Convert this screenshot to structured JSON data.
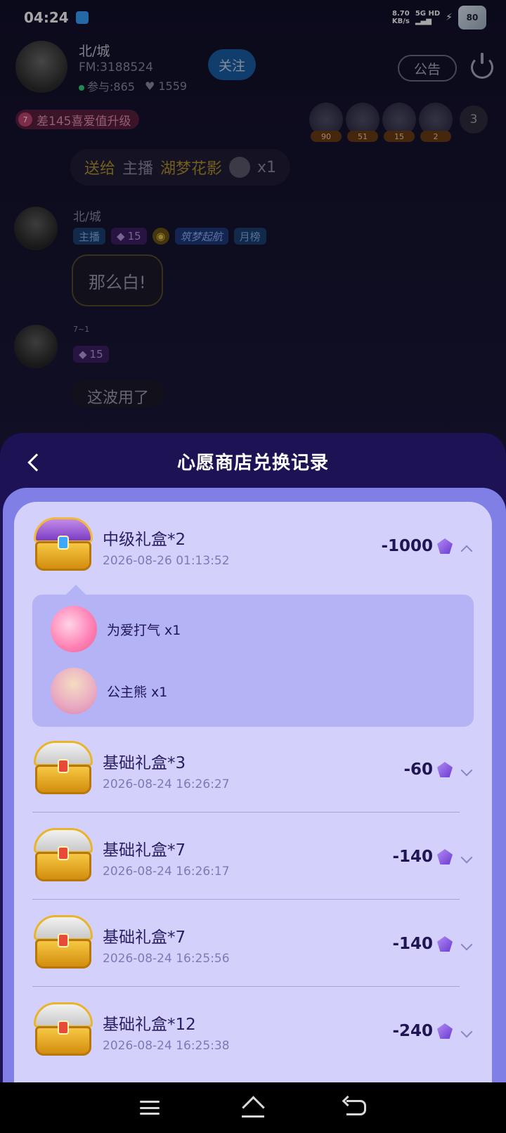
{
  "status_bar": {
    "time": "04:24",
    "net_speed": "8.70",
    "net_unit": "KB/s",
    "network": "5G HD",
    "battery": "80"
  },
  "room": {
    "host_name": "北/城",
    "fm_id": "FM:3188524",
    "participants": "参与:865",
    "likes": "1559",
    "follow_label": "关注",
    "notice_label": "公告",
    "love_level_num": "7",
    "love_level_text": "差145喜爱值升级",
    "viewers": [
      {
        "tag": "90"
      },
      {
        "tag": "51"
      },
      {
        "tag": "15"
      },
      {
        "tag": "2"
      }
    ],
    "viewer_count": "3",
    "gift_msg": {
      "prefix": "送给",
      "role": "主播",
      "target": "湖梦花影",
      "count": "x1"
    },
    "chat": [
      {
        "name": "北/城",
        "badges": [
          "主播",
          "15",
          "",
          "筑梦起航",
          "月榜"
        ],
        "message": "那么白!"
      },
      {
        "name": "7~1",
        "badges": [
          "15"
        ],
        "message": "这波用了"
      }
    ]
  },
  "sheet": {
    "title": "心愿商店兑换记录",
    "records": [
      {
        "title": "中级礼盒*2",
        "time": "2026-08-26 01:13:52",
        "amount": "-1000",
        "expanded": true,
        "items": [
          {
            "label": "为爱打气 x1"
          },
          {
            "label": "公主熊 x1"
          }
        ]
      },
      {
        "title": "基础礼盒*3",
        "time": "2026-08-24 16:26:27",
        "amount": "-60"
      },
      {
        "title": "基础礼盒*7",
        "time": "2026-08-24 16:26:17",
        "amount": "-140"
      },
      {
        "title": "基础礼盒*7",
        "time": "2026-08-24 16:25:56",
        "amount": "-140"
      },
      {
        "title": "基础礼盒*12",
        "time": "2026-08-24 16:25:38",
        "amount": "-240"
      }
    ]
  },
  "colors": {
    "sheet_bg": "#1c1254",
    "body_bg": "#7f7fe6",
    "card_bg": "#d3d1fb",
    "detail_bg": "#b4b3f5",
    "title_text": "#2a1e63",
    "time_text": "#7e79b7"
  },
  "icons": [
    "back-icon",
    "diamond-icon",
    "chevron-down-icon",
    "chevron-up-icon",
    "power-icon",
    "treasure-chest-icon",
    "menu-icon",
    "home-icon",
    "back-nav-icon"
  ]
}
